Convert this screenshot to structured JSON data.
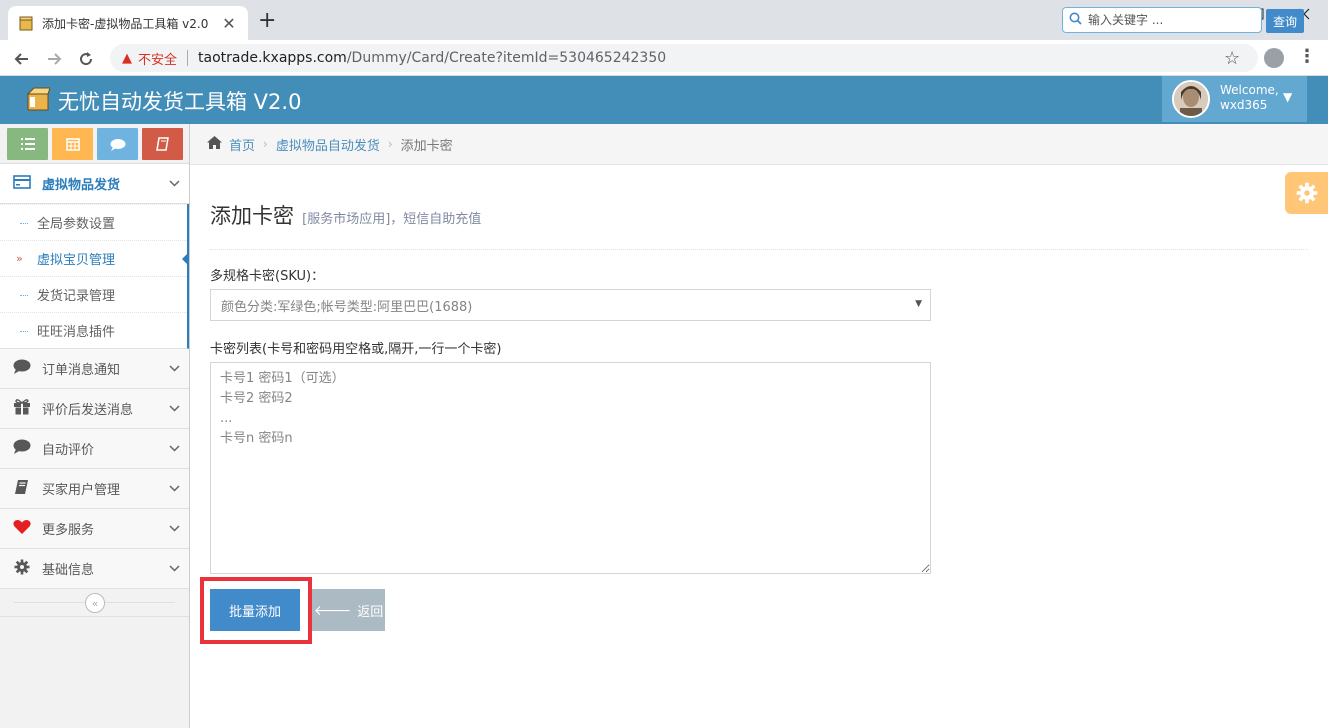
{
  "browser": {
    "tab_title": "添加卡密-虚拟物品工具箱 v2.0",
    "tab_close": "✕",
    "new_tab": "+",
    "insecure_label": "不安全",
    "url_host": "taotrade.kxapps.com",
    "url_path": "/Dummy/Card/Create?itemId=530465242350"
  },
  "header": {
    "brand": "无忧自动发货工具箱 V2.0",
    "welcome": "Welcome,",
    "username": "wxd365"
  },
  "sidebar": {
    "active_menu": {
      "label": "虚拟物品发货",
      "icon": "credit-card-icon"
    },
    "submenu": [
      {
        "label": "全局参数设置",
        "active": false
      },
      {
        "label": "虚拟宝贝管理",
        "active": true
      },
      {
        "label": "发货记录管理",
        "active": false
      },
      {
        "label": "旺旺消息插件",
        "active": false
      }
    ],
    "menus": [
      {
        "label": "订单消息通知",
        "icon": "comment-icon"
      },
      {
        "label": "评价后发送消息",
        "icon": "gift-icon"
      },
      {
        "label": "自动评价",
        "icon": "comment-icon"
      },
      {
        "label": "买家用户管理",
        "icon": "book-icon"
      },
      {
        "label": "更多服务",
        "icon": "heart-icon"
      },
      {
        "label": "基础信息",
        "icon": "gear-icon"
      }
    ]
  },
  "breadcrumbs": {
    "home": "首页",
    "section": "虚拟物品自动发货",
    "current": "添加卡密"
  },
  "search": {
    "placeholder": "输入关键字 ...",
    "button": "查询"
  },
  "page": {
    "title": "添加卡密",
    "subtitle": "[服务市场应用]，短信自助充值",
    "sku_label": "多规格卡密(SKU)：",
    "sku_selected": "颜色分类:军绿色;帐号类型:阿里巴巴(1688)",
    "cards_label": "卡密列表(卡号和密码用空格或,隔开,一行一个卡密)",
    "cards_placeholder": "卡号1 密码1（可选）\n卡号2 密码2\n...\n卡号n 密码n",
    "submit_button": "批量添加",
    "back_button": "返回"
  },
  "colors": {
    "header_bg": "#438eb9",
    "primary": "#428bca",
    "highlight": "#e8333a"
  }
}
